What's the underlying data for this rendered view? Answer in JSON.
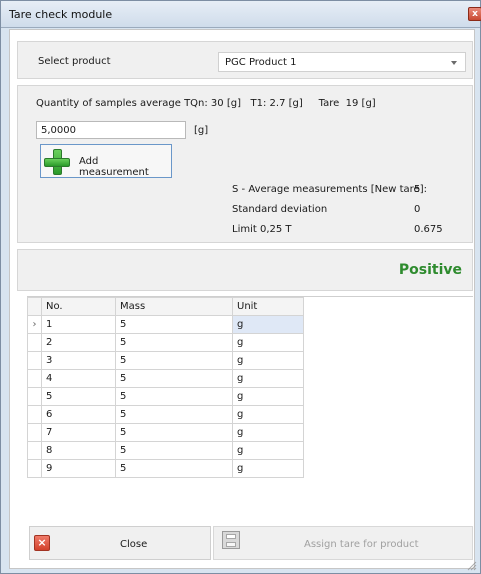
{
  "window": {
    "title": "Tare check module",
    "close_glyph": "x"
  },
  "product": {
    "label": "Select product",
    "selected": "PGC Product 1"
  },
  "measure": {
    "summary": "Quantity of samples average TQn: 30 [g]   T1: 2.7 [g]     Tare  19 [g]",
    "input_value": "5,0000",
    "unit": "[g]",
    "add_button": "Add measurement",
    "stats": [
      {
        "label": "S - Average measurements [New tare]:",
        "value": "5"
      },
      {
        "label": "Standard deviation",
        "value": "0"
      },
      {
        "label": "Limit 0,25 T",
        "value": "0.675"
      }
    ]
  },
  "result": {
    "text": "Positive",
    "color": "#2e8b2e"
  },
  "grid": {
    "columns": [
      "No.",
      "Mass",
      "Unit"
    ],
    "row_indicator": "›",
    "rows": [
      {
        "no": "1",
        "mass": "5",
        "unit": "g"
      },
      {
        "no": "2",
        "mass": "5",
        "unit": "g"
      },
      {
        "no": "3",
        "mass": "5",
        "unit": "g"
      },
      {
        "no": "4",
        "mass": "5",
        "unit": "g"
      },
      {
        "no": "5",
        "mass": "5",
        "unit": "g"
      },
      {
        "no": "6",
        "mass": "5",
        "unit": "g"
      },
      {
        "no": "7",
        "mass": "5",
        "unit": "g"
      },
      {
        "no": "8",
        "mass": "5",
        "unit": "g"
      },
      {
        "no": "9",
        "mass": "5",
        "unit": "g"
      }
    ]
  },
  "buttons": {
    "close": "Close",
    "assign": "Assign tare for product"
  },
  "icons": {
    "close_icon": "close-icon",
    "add_icon": "plus-icon",
    "save_icon": "save-icon"
  }
}
